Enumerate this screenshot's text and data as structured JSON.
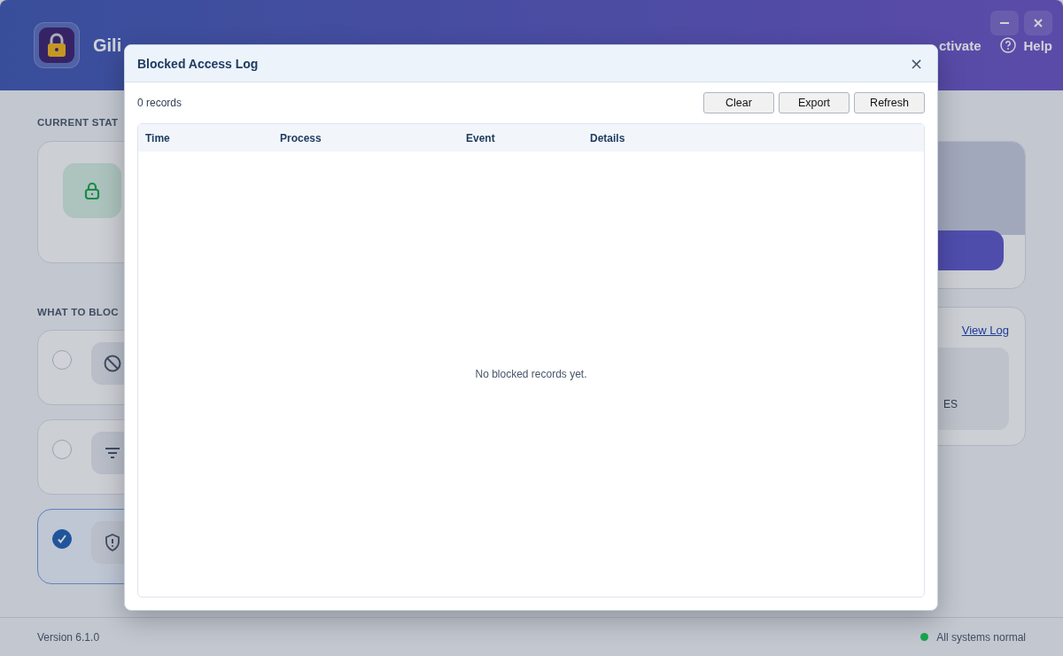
{
  "app": {
    "title": "Gili",
    "header_links": [
      {
        "label": "ctivate",
        "kind": "text"
      },
      {
        "label": "Help",
        "kind": "help"
      }
    ]
  },
  "status_section": {
    "heading": "CURRENT STAT",
    "locked": true
  },
  "block_section": {
    "heading": "WHAT TO BLOC",
    "options": [
      {
        "kind": "block",
        "selected": false
      },
      {
        "kind": "filter",
        "selected": false
      },
      {
        "kind": "shield",
        "selected": true
      }
    ]
  },
  "log_card": {
    "link": "View Log",
    "summary_text": "ES"
  },
  "status_bar": {
    "version": "Version 6.1.0",
    "status": "All systems normal",
    "color": "#16a34a"
  },
  "dialog": {
    "title": "Blocked Access Log",
    "close": "×",
    "count": "0 records",
    "buttons": [
      "Clear",
      "Export",
      "Refresh"
    ],
    "table": {
      "columns": [
        "Time",
        "Process",
        "Event",
        "Details"
      ],
      "empty_message": "No blocked records yet."
    }
  }
}
